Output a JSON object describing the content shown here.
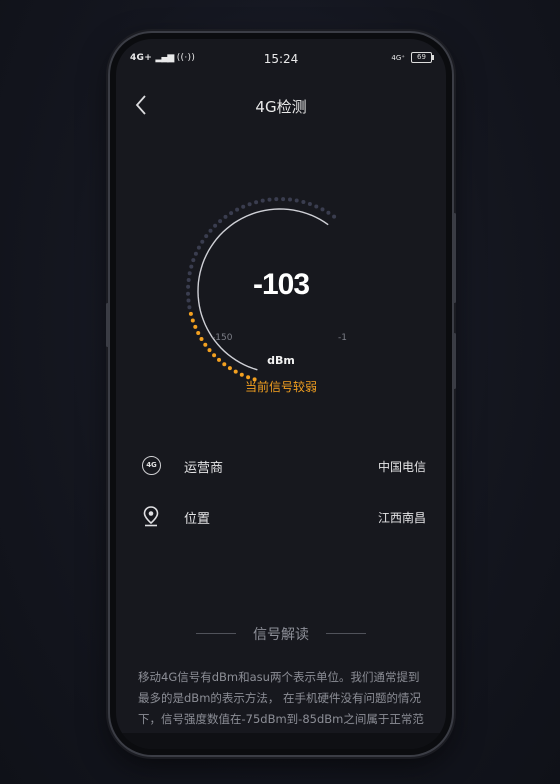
{
  "status_bar": {
    "network": "4G+",
    "time": "15:24",
    "right_network": "4G⁺",
    "battery": "69"
  },
  "header": {
    "back_icon": "chevron-left-icon",
    "title": "4G检测"
  },
  "gauge": {
    "value": "-103",
    "unit": "dBm",
    "min_label": "-150",
    "max_label": "-1",
    "min": -150,
    "max": -1,
    "current": -103,
    "status": "当前信号较弱",
    "colors": {
      "active": "#f3a020",
      "inactive": "#3a3d4f",
      "arc": "#cfd0d6"
    }
  },
  "info_rows": [
    {
      "icon": "4g-circle-icon",
      "icon_text": "4G",
      "label": "运营商",
      "value": "中国电信"
    },
    {
      "icon": "location-pin-icon",
      "label": "位置",
      "value": "江西南昌"
    }
  ],
  "section": {
    "title": "信号解读",
    "paragraph": "移动4G信号有dBm和asu两个表示单位。我们通常提到最多的是dBm的表示方法， 在手机硬件没有问题的情况下，信号强度数值在-75dBm到-85dBm之间属于正常范"
  }
}
